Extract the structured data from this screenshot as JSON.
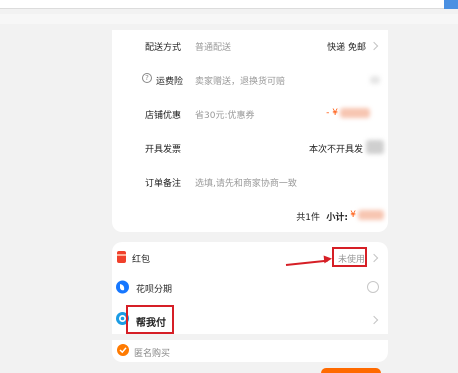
{
  "shipping": {
    "label": "配送方式",
    "sub": "普通配送",
    "value": "快递 免邮"
  },
  "freight_insurance": {
    "label": "运费险",
    "sub": "卖家赠送，退换货可赔"
  },
  "shop_discount": {
    "label": "店铺优惠",
    "sub": "省30元:优惠券",
    "value": "- ¥"
  },
  "invoice": {
    "label": "开具发票",
    "value": "本次不开具发"
  },
  "order_note": {
    "label": "订单备注",
    "placeholder": "选填,请先和商家协商一致"
  },
  "subtotal": {
    "count": "共1件",
    "label": "小计:",
    "currency": "¥"
  },
  "payment": {
    "red_packet": {
      "label": "红包",
      "status": "未使用"
    },
    "huabei": {
      "label": "花呗分期"
    },
    "help_pay": {
      "label": "帮我付"
    },
    "anonymous": {
      "label": "匿名购买"
    }
  },
  "colors": {
    "accent": "#ff5000",
    "annotation": "#d61f26",
    "alipay_blue": "#1677ff"
  },
  "icons": [
    "question-icon",
    "chevron-right-icon",
    "red-packet-icon",
    "huabei-icon",
    "help-pay-icon",
    "check-circle-icon"
  ]
}
